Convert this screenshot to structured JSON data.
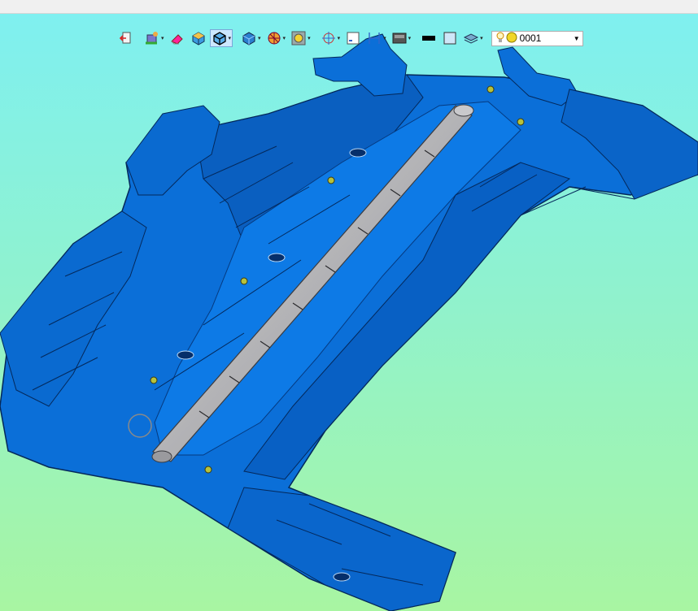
{
  "window": {
    "titlebar": ""
  },
  "toolbar": {
    "buttons": [
      {
        "id": "exit",
        "icon": "exit-door-icon",
        "dropdown": false
      },
      {
        "id": "paint",
        "icon": "paint-bucket-icon",
        "dropdown": true
      },
      {
        "id": "eraser",
        "icon": "eraser-icon",
        "dropdown": false
      },
      {
        "id": "shaded",
        "icon": "shaded-cube-icon",
        "dropdown": false
      },
      {
        "id": "shaded-edges",
        "icon": "shaded-edges-cube-icon",
        "dropdown": true,
        "active": true
      },
      {
        "id": "view-orient",
        "icon": "view-cube-icon",
        "dropdown": true
      },
      {
        "id": "render",
        "icon": "render-sphere-icon",
        "dropdown": true
      },
      {
        "id": "appearance",
        "icon": "appearance-circle-icon",
        "dropdown": true
      },
      {
        "id": "triad",
        "icon": "triad-axis-icon",
        "dropdown": true
      },
      {
        "id": "section",
        "icon": "section-view-icon",
        "dropdown": false
      },
      {
        "id": "dimension",
        "icon": "dimension-icon",
        "dropdown": true
      },
      {
        "id": "shadow",
        "icon": "shadow-plane-icon",
        "dropdown": true
      },
      {
        "id": "line-color",
        "icon": "line-color-icon",
        "dropdown": false
      },
      {
        "id": "background",
        "icon": "background-square-icon",
        "dropdown": false
      },
      {
        "id": "layers",
        "icon": "layers-icon",
        "dropdown": true
      }
    ],
    "layer": {
      "value": "0001",
      "light_icon": "lightbulb-icon",
      "state_icon": "yellow-circle-icon"
    }
  },
  "colors": {
    "part": "#0a6fd6",
    "part_dark": "#07418a",
    "shaft": "#b5b5b7",
    "bg_top": "#7ff0f0",
    "bg_bottom": "#a8f5a2"
  }
}
